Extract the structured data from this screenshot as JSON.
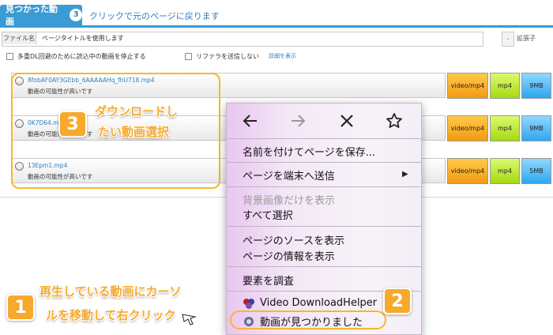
{
  "header": {
    "tab_label": "見つかった動画",
    "tab_count": "3",
    "back_link": "クリックで元のページに戻ります"
  },
  "filename": {
    "label": "ファイル名",
    "value": "ページタイトルを使用します",
    "dot": ".",
    "ext_label": "拡張子"
  },
  "options": {
    "stop_dl": "多重DL回避のために読込中の動画を停止する",
    "no_referer": "リファラを送信しない",
    "details": "詳細を表示"
  },
  "videos": [
    {
      "name": "8fobAF0AY3GEbb_6AAAAAHq_fhU718.mp4",
      "note": "動画の可能性が高いです",
      "type": "video/mp4",
      "ext": "mp4",
      "size": "9MB"
    },
    {
      "name": "0K7D64.mp4",
      "note": "動画の可能性が高いです",
      "type": "video/mp4",
      "ext": "mp4",
      "size": "9MB"
    },
    {
      "name": "13Epm1.mp4",
      "note": "動画の可能性が高いです",
      "type": "video/mp4",
      "ext": "mp4",
      "size": "5MB"
    }
  ],
  "context_menu": {
    "nav_icons": [
      "back-arrow-icon",
      "forward-arrow-icon",
      "close-x-icon",
      "star-icon"
    ],
    "save_as": "名前を付けてページを保存...",
    "send_to_device": "ページを端末へ送信",
    "view_bg_image": "背景画像だけを表示",
    "select_all": "すべて選択",
    "view_source": "ページのソースを表示",
    "page_info": "ページの情報を表示",
    "inspect": "要素を調査",
    "vdh": "Video DownloadHelper",
    "video_found": "動画が見つかりました"
  },
  "callouts": {
    "step1_number": "1",
    "step1_text_line1": "再生している動画にカーソ",
    "step1_text_line2": "ルを移動して右クリック",
    "step2_number": "2",
    "step3_number": "3",
    "step3_text_line1": "ダウンロードし",
    "step3_text_line2": "たい動画選択",
    "accent_color": "#f7a92b"
  },
  "colors": {
    "header_blue": "#3a9bd5",
    "link_blue": "#2f7fbf",
    "type_button": "#f29a13",
    "ext_button": "#a5d915",
    "size_button": "#2ea6ef"
  }
}
